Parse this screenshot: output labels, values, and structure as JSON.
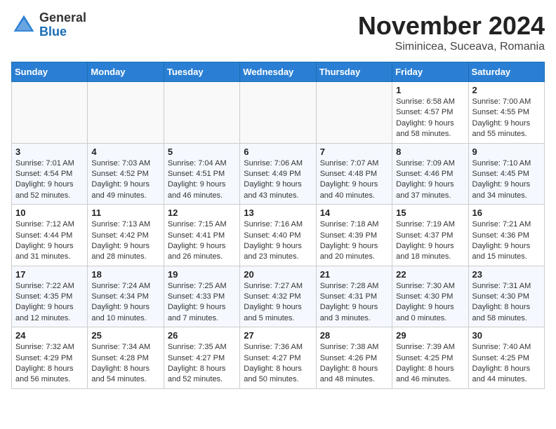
{
  "header": {
    "logo_general": "General",
    "logo_blue": "Blue",
    "month": "November 2024",
    "location": "Siminicea, Suceava, Romania"
  },
  "weekdays": [
    "Sunday",
    "Monday",
    "Tuesday",
    "Wednesday",
    "Thursday",
    "Friday",
    "Saturday"
  ],
  "weeks": [
    [
      {
        "day": "",
        "empty": true
      },
      {
        "day": "",
        "empty": true
      },
      {
        "day": "",
        "empty": true
      },
      {
        "day": "",
        "empty": true
      },
      {
        "day": "",
        "empty": true
      },
      {
        "day": "1",
        "sunrise": "6:58 AM",
        "sunset": "4:57 PM",
        "daylight": "9 hours and 58 minutes."
      },
      {
        "day": "2",
        "sunrise": "7:00 AM",
        "sunset": "4:55 PM",
        "daylight": "9 hours and 55 minutes."
      }
    ],
    [
      {
        "day": "3",
        "sunrise": "7:01 AM",
        "sunset": "4:54 PM",
        "daylight": "9 hours and 52 minutes."
      },
      {
        "day": "4",
        "sunrise": "7:03 AM",
        "sunset": "4:52 PM",
        "daylight": "9 hours and 49 minutes."
      },
      {
        "day": "5",
        "sunrise": "7:04 AM",
        "sunset": "4:51 PM",
        "daylight": "9 hours and 46 minutes."
      },
      {
        "day": "6",
        "sunrise": "7:06 AM",
        "sunset": "4:49 PM",
        "daylight": "9 hours and 43 minutes."
      },
      {
        "day": "7",
        "sunrise": "7:07 AM",
        "sunset": "4:48 PM",
        "daylight": "9 hours and 40 minutes."
      },
      {
        "day": "8",
        "sunrise": "7:09 AM",
        "sunset": "4:46 PM",
        "daylight": "9 hours and 37 minutes."
      },
      {
        "day": "9",
        "sunrise": "7:10 AM",
        "sunset": "4:45 PM",
        "daylight": "9 hours and 34 minutes."
      }
    ],
    [
      {
        "day": "10",
        "sunrise": "7:12 AM",
        "sunset": "4:44 PM",
        "daylight": "9 hours and 31 minutes."
      },
      {
        "day": "11",
        "sunrise": "7:13 AM",
        "sunset": "4:42 PM",
        "daylight": "9 hours and 28 minutes."
      },
      {
        "day": "12",
        "sunrise": "7:15 AM",
        "sunset": "4:41 PM",
        "daylight": "9 hours and 26 minutes."
      },
      {
        "day": "13",
        "sunrise": "7:16 AM",
        "sunset": "4:40 PM",
        "daylight": "9 hours and 23 minutes."
      },
      {
        "day": "14",
        "sunrise": "7:18 AM",
        "sunset": "4:39 PM",
        "daylight": "9 hours and 20 minutes."
      },
      {
        "day": "15",
        "sunrise": "7:19 AM",
        "sunset": "4:37 PM",
        "daylight": "9 hours and 18 minutes."
      },
      {
        "day": "16",
        "sunrise": "7:21 AM",
        "sunset": "4:36 PM",
        "daylight": "9 hours and 15 minutes."
      }
    ],
    [
      {
        "day": "17",
        "sunrise": "7:22 AM",
        "sunset": "4:35 PM",
        "daylight": "9 hours and 12 minutes."
      },
      {
        "day": "18",
        "sunrise": "7:24 AM",
        "sunset": "4:34 PM",
        "daylight": "9 hours and 10 minutes."
      },
      {
        "day": "19",
        "sunrise": "7:25 AM",
        "sunset": "4:33 PM",
        "daylight": "9 hours and 7 minutes."
      },
      {
        "day": "20",
        "sunrise": "7:27 AM",
        "sunset": "4:32 PM",
        "daylight": "9 hours and 5 minutes."
      },
      {
        "day": "21",
        "sunrise": "7:28 AM",
        "sunset": "4:31 PM",
        "daylight": "9 hours and 3 minutes."
      },
      {
        "day": "22",
        "sunrise": "7:30 AM",
        "sunset": "4:30 PM",
        "daylight": "9 hours and 0 minutes."
      },
      {
        "day": "23",
        "sunrise": "7:31 AM",
        "sunset": "4:30 PM",
        "daylight": "8 hours and 58 minutes."
      }
    ],
    [
      {
        "day": "24",
        "sunrise": "7:32 AM",
        "sunset": "4:29 PM",
        "daylight": "8 hours and 56 minutes."
      },
      {
        "day": "25",
        "sunrise": "7:34 AM",
        "sunset": "4:28 PM",
        "daylight": "8 hours and 54 minutes."
      },
      {
        "day": "26",
        "sunrise": "7:35 AM",
        "sunset": "4:27 PM",
        "daylight": "8 hours and 52 minutes."
      },
      {
        "day": "27",
        "sunrise": "7:36 AM",
        "sunset": "4:27 PM",
        "daylight": "8 hours and 50 minutes."
      },
      {
        "day": "28",
        "sunrise": "7:38 AM",
        "sunset": "4:26 PM",
        "daylight": "8 hours and 48 minutes."
      },
      {
        "day": "29",
        "sunrise": "7:39 AM",
        "sunset": "4:25 PM",
        "daylight": "8 hours and 46 minutes."
      },
      {
        "day": "30",
        "sunrise": "7:40 AM",
        "sunset": "4:25 PM",
        "daylight": "8 hours and 44 minutes."
      }
    ]
  ]
}
